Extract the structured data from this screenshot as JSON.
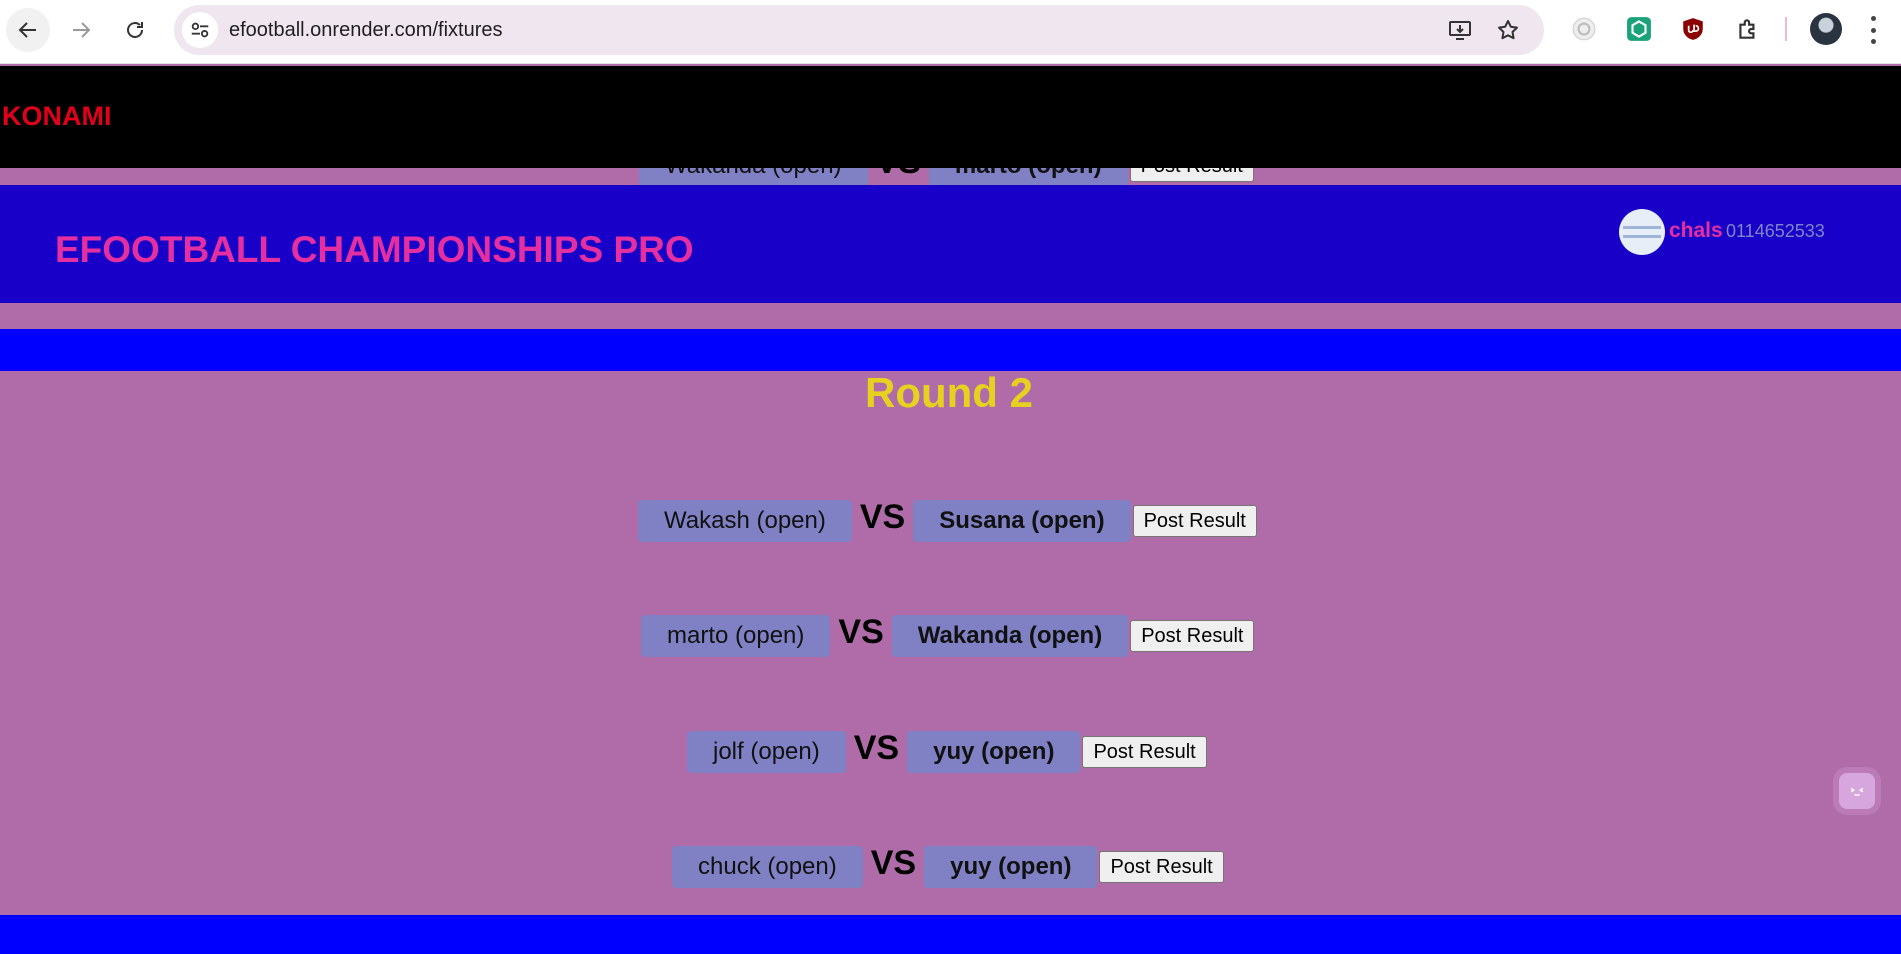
{
  "browser": {
    "url": "efootball.onrender.com/fixtures"
  },
  "page": {
    "brand": "KONAMI",
    "site_title": "EFOOTBALL CHAMPIONSHIPS PRO",
    "user": {
      "name": "chals",
      "phone": "0114652533"
    },
    "round_title": "Round 2",
    "vs_label": "VS",
    "post_button_label": "Post Result",
    "partially_hidden_fixture": {
      "home": "Wakanda (open)",
      "away": "marto (open)"
    },
    "fixtures": [
      {
        "home": "Wakash (open)",
        "away": "Susana (open)"
      },
      {
        "home": "marto (open)",
        "away": "Wakanda (open)"
      },
      {
        "home": "jolf (open)",
        "away": "yuy (open)"
      },
      {
        "home": "chuck (open)",
        "away": "yuy (open)"
      }
    ]
  },
  "colors": {
    "page_bg": "#b06ca8",
    "brand_bar": "#000000",
    "brand_text": "#e0001b",
    "header_band": "#1800c8",
    "title_text": "#e52fa0",
    "accent_band": "#0000ff",
    "round_title": "#e6d11f",
    "team_box": "#8080c4"
  }
}
